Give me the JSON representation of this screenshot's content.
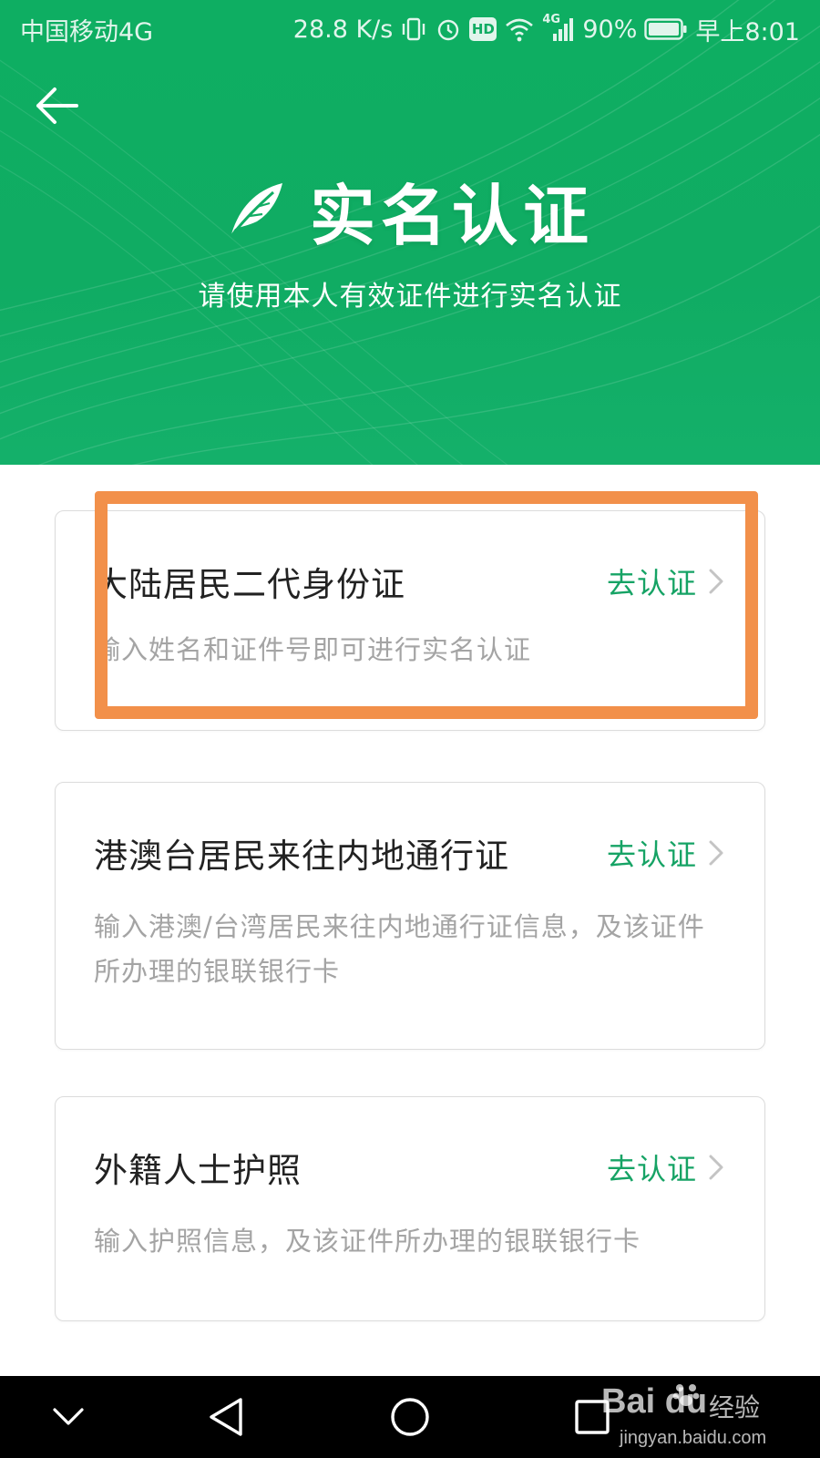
{
  "status_bar": {
    "carrier": "中国移动4G",
    "net_speed": "28.8 K/s",
    "hd_badge": "HD",
    "network_type": "4G",
    "battery": "90%",
    "time": "早上8:01"
  },
  "header": {
    "title": "实名认证",
    "subtitle": "请使用本人有效证件进行实名认证"
  },
  "cards": [
    {
      "title": "大陆居民二代身份证",
      "action": "去认证",
      "description": "输入姓名和证件号即可进行实名认证"
    },
    {
      "title": "港澳台居民来往内地通行证",
      "action": "去认证",
      "description": "输入港澳/台湾居民来往内地通行证信息，及该证件所办理的银联银行卡"
    },
    {
      "title": "外籍人士护照",
      "action": "去认证",
      "description": "输入护照信息，及该证件所办理的银联银行卡"
    }
  ],
  "watermark": {
    "brand": "Bai du",
    "label": "经验",
    "url": "jingyan.baidu.com"
  },
  "colors": {
    "header_green": "#10ac63",
    "action_green": "#16a365",
    "highlight_orange": "#f2904a"
  },
  "icons": {
    "back": "arrow-left-icon",
    "title": "feather-icon",
    "action": "chevron-right-icon"
  }
}
